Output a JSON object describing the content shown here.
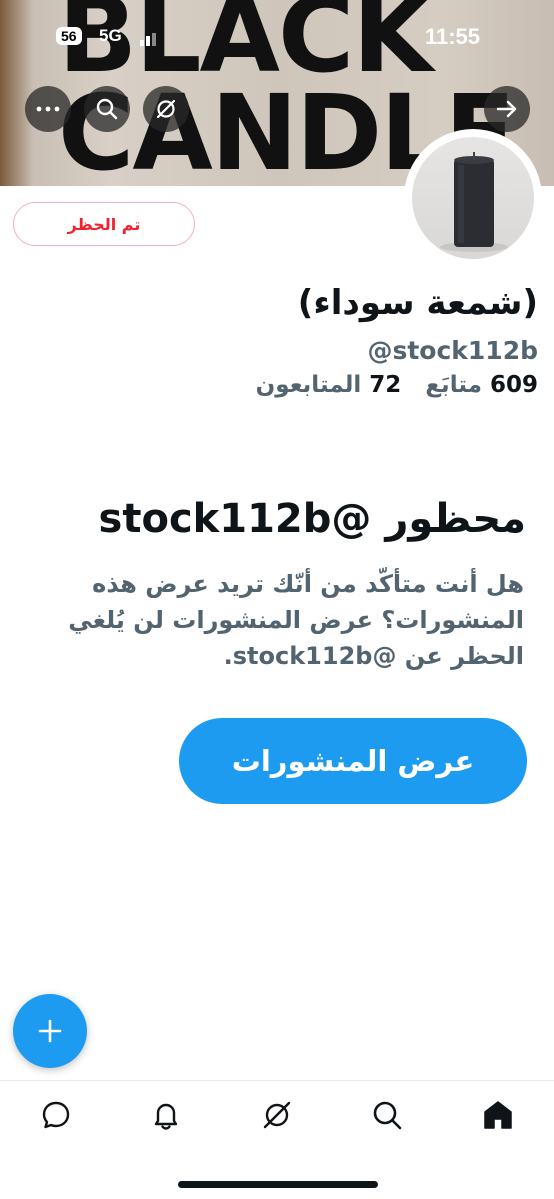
{
  "status_bar": {
    "time": "11:55",
    "badge": "56",
    "network": "5G"
  },
  "banner": {
    "line1": "BLACK",
    "line2": "CANDLE"
  },
  "header_actions": {
    "more_icon": "more-icon",
    "search_icon": "search-icon",
    "grok_icon": "grok-icon",
    "forward_icon": "arrow-right-icon"
  },
  "profile": {
    "blocked_label": "تم الحظر",
    "name": "(شمعة سوداء)",
    "handle": "@stock112b",
    "following_count": "609",
    "following_label": "متابَع",
    "followers_count": "72",
    "followers_label": "المتابعون"
  },
  "blocked_notice": {
    "title": "محظور @stock112b",
    "description": "هل أنت متأكّد من أنّك تريد عرض هذه المنشورات؟ عرض المنشورات لن يُلغي الحظر عن @stock112b.",
    "button_label": "عرض المنشورات"
  },
  "colors": {
    "accent": "#1d9bf0",
    "danger": "#f4212e",
    "muted": "#536471",
    "text": "#0f1419"
  },
  "bottom_nav": [
    "messages-icon",
    "notifications-icon",
    "grok-icon",
    "search-icon",
    "home-icon"
  ]
}
